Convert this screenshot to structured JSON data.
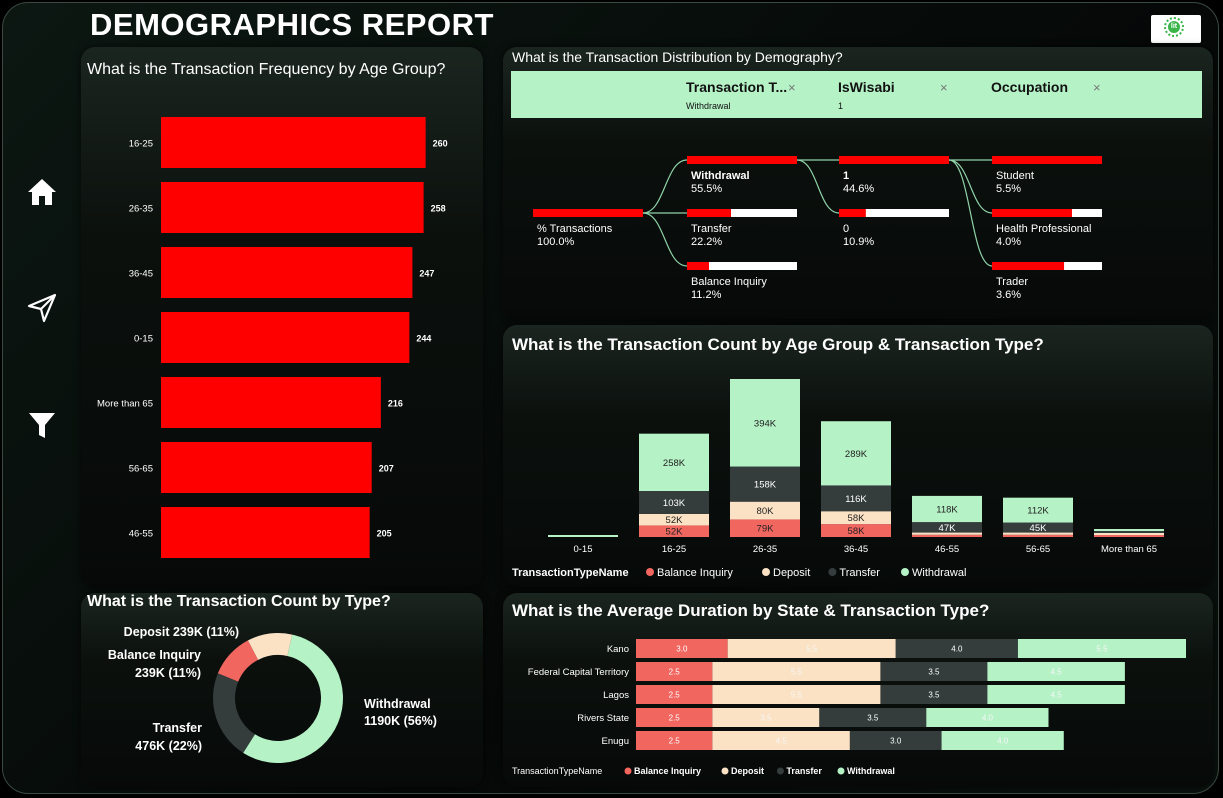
{
  "header": {
    "title": "DEMOGRAPHICS REPORT",
    "logo_text": "lit"
  },
  "nav": [
    {
      "name": "home-icon"
    },
    {
      "name": "send-icon"
    },
    {
      "name": "filter-icon"
    }
  ],
  "panels": {
    "age_freq": {
      "title": "What is the Transaction Frequency by Age Group?"
    },
    "decomp": {
      "title": "What is the Transaction Distribution by Demography?",
      "header": [
        {
          "label": "Transaction T...",
          "value": "Withdrawal"
        },
        {
          "label": "IsWisabi",
          "value": "1"
        },
        {
          "label": "Occupation",
          "value": ""
        }
      ],
      "close_glyph": "×",
      "root": {
        "label": "% Transactions",
        "value": "100.0%",
        "fraction": 1.0
      },
      "level1": [
        {
          "label": "Withdrawal",
          "value": "55.5%",
          "fraction": 1.0,
          "bold": true
        },
        {
          "label": "Transfer",
          "value": "22.2%",
          "fraction": 0.4
        },
        {
          "label": "Balance Inquiry",
          "value": "11.2%",
          "fraction": 0.2
        }
      ],
      "level2": [
        {
          "label": "1",
          "value": "44.6%",
          "fraction": 1.0,
          "bold": true
        },
        {
          "label": "0",
          "value": "10.9%",
          "fraction": 0.244
        }
      ],
      "level3": [
        {
          "label": "Student",
          "value": "5.5%",
          "fraction": 1.0
        },
        {
          "label": "Health Professional",
          "value": "4.0%",
          "fraction": 0.727
        },
        {
          "label": "Trader",
          "value": "3.6%",
          "fraction": 0.655
        }
      ]
    },
    "stacked": {
      "title": "What is the Transaction Count by Age Group & Transaction Type?"
    },
    "donut": {
      "title": "What is the Transaction Count by Type?"
    },
    "duration": {
      "title": "What is the Average Duration by State & Transaction Type?"
    }
  },
  "chart_data": [
    {
      "type": "bar",
      "orientation": "horizontal",
      "categories": [
        "16-25",
        "26-35",
        "36-45",
        "0-15",
        "More than 65",
        "56-65",
        "46-55"
      ],
      "values": [
        260,
        258,
        247,
        244,
        216,
        207,
        205
      ],
      "labels": [
        "260",
        "258",
        "247",
        "244",
        "216",
        "207",
        "205"
      ],
      "xlim": [
        0,
        280
      ],
      "color": "#ff0000"
    },
    {
      "type": "bar",
      "stacked": true,
      "categories": [
        "0-15",
        "16-25",
        "26-35",
        "36-45",
        "46-55",
        "56-65",
        "More than 65"
      ],
      "legend_title": "TransactionTypeName",
      "legend_position": "bottom",
      "series": [
        {
          "name": "Balance Inquiry",
          "color": "#f26660",
          "values": [
            0,
            52,
            79,
            58,
            10,
            10,
            1
          ],
          "labels": [
            "",
            "52K",
            "79K",
            "58K",
            "",
            "",
            ""
          ]
        },
        {
          "name": "Deposit",
          "color": "#fbe2c4",
          "values": [
            0,
            52,
            80,
            58,
            10,
            10,
            1
          ],
          "labels": [
            "",
            "52K",
            "80K",
            "58K",
            "",
            "",
            ""
          ]
        },
        {
          "name": "Transfer",
          "color": "#343c3c",
          "values": [
            0,
            103,
            158,
            116,
            47,
            45,
            1
          ],
          "labels": [
            "",
            "103K",
            "158K",
            "116K",
            "47K",
            "45K",
            ""
          ]
        },
        {
          "name": "Withdrawal",
          "color": "#b5f2c6",
          "values": [
            5,
            258,
            394,
            289,
            118,
            112,
            5
          ],
          "labels": [
            "",
            "258K",
            "394K",
            "289K",
            "118K",
            "112K",
            ""
          ]
        }
      ],
      "ylim": [
        0,
        720
      ]
    },
    {
      "type": "pie",
      "donut": true,
      "slices": [
        {
          "name": "Withdrawal",
          "value": 1190,
          "color": "#b5f2c6",
          "label_line1": "Withdrawal",
          "label_line2": "1190K (56%)"
        },
        {
          "name": "Transfer",
          "value": 476,
          "color": "#343c3c",
          "label_line1": "Transfer",
          "label_line2": "476K (22%)"
        },
        {
          "name": "Balance Inquiry",
          "value": 239,
          "color": "#f26660",
          "label_line1": "Balance Inquiry",
          "label_line2": "239K (11%)"
        },
        {
          "name": "Deposit",
          "value": 239,
          "color": "#fbe2c4",
          "label_line1": "Deposit 239K (11%)",
          "label_line2": ""
        }
      ]
    },
    {
      "type": "bar",
      "orientation": "horizontal",
      "stacked": true,
      "categories": [
        "Kano",
        "Federal Capital Territory",
        "Lagos",
        "Rivers State",
        "Enugu"
      ],
      "legend_title": "TransactionTypeName",
      "legend_position": "bottom",
      "series": [
        {
          "name": "Balance Inquiry",
          "color": "#f26660",
          "values": [
            3.0,
            2.5,
            2.5,
            2.5,
            2.5
          ],
          "labels": [
            "3.0",
            "2.5",
            "2.5",
            "2.5",
            "2.5"
          ]
        },
        {
          "name": "Deposit",
          "color": "#fbe2c4",
          "values": [
            5.5,
            5.5,
            5.5,
            3.5,
            4.5
          ],
          "labels": [
            "5.5",
            "5.5",
            "5.5",
            "3.5",
            "4.5"
          ]
        },
        {
          "name": "Transfer",
          "color": "#343c3c",
          "values": [
            4.0,
            3.5,
            3.5,
            3.5,
            3.0
          ],
          "labels": [
            "4.0",
            "3.5",
            "3.5",
            "3.5",
            "3.0"
          ]
        },
        {
          "name": "Withdrawal",
          "color": "#b5f2c6",
          "values": [
            5.5,
            4.5,
            4.5,
            4.0,
            4.0
          ],
          "labels": [
            "5.5",
            "4.5",
            "4.5",
            "4.0",
            "4.0"
          ]
        }
      ],
      "xlim": [
        0,
        18
      ]
    }
  ]
}
